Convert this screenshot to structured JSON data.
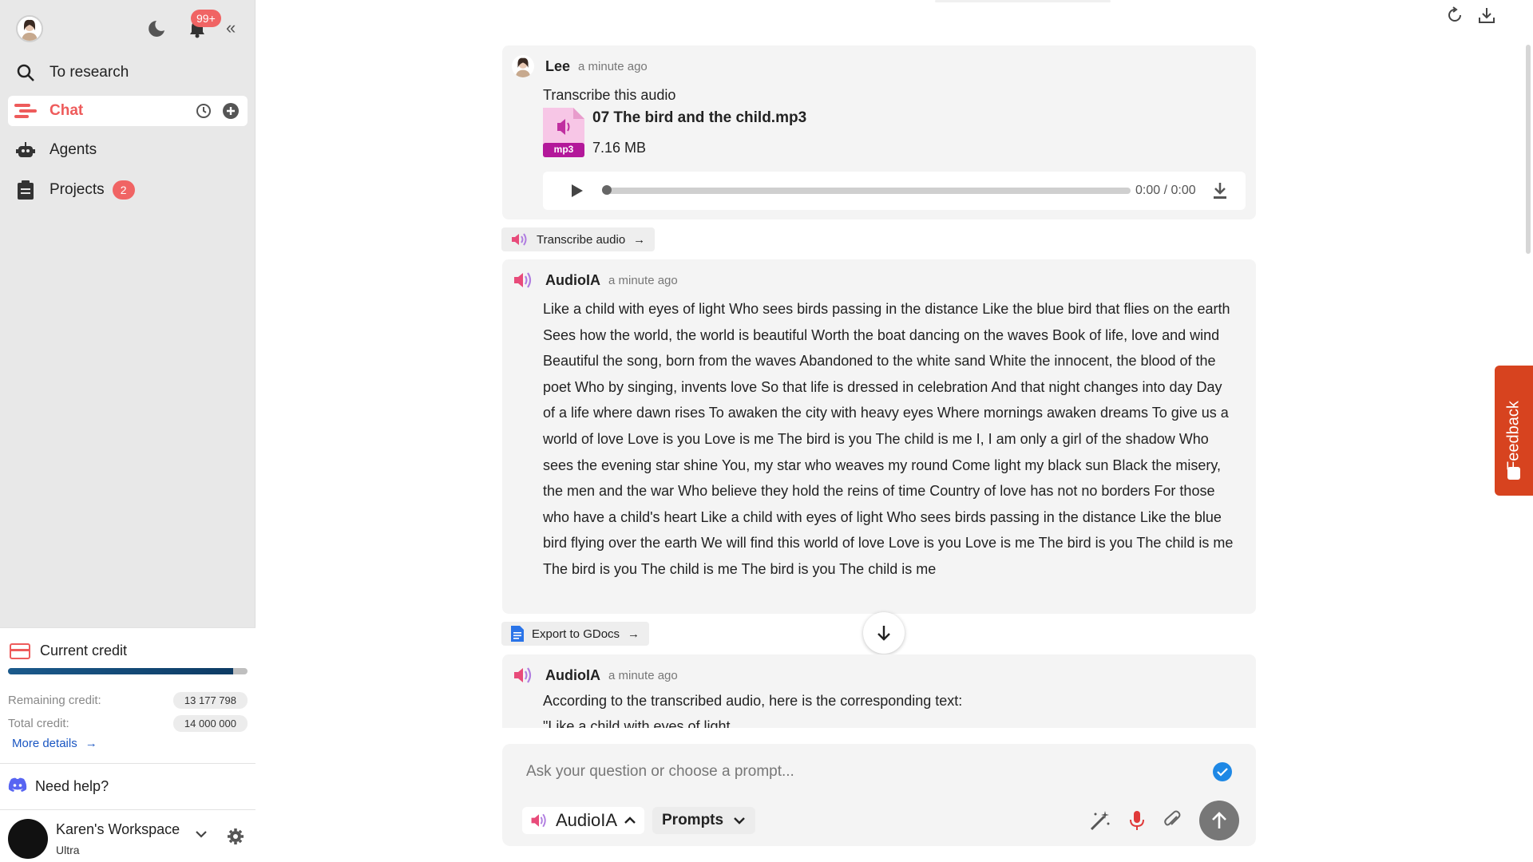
{
  "sidebar": {
    "notifications_badge": "99+",
    "search_label": "To research",
    "nav": {
      "chat": "Chat",
      "agents": "Agents",
      "projects": "Projects",
      "projects_badge": "2"
    },
    "credit": {
      "title": "Current credit",
      "remaining_label": "Remaining credit:",
      "remaining_value": "13 177 798",
      "total_label": "Total credit:",
      "total_value": "14 000 000",
      "progress_fraction": 0.94,
      "more_details": "More details"
    },
    "help": "Need help?",
    "workspace": {
      "name": "Karen's Workspace",
      "plan": "Ultra"
    }
  },
  "messages": {
    "user": {
      "name": "Lee",
      "time": "a minute ago",
      "text": "Transcribe this audio",
      "file_name": "07 The bird and the child.mp3",
      "file_ext": "mp3",
      "file_size": "7.16 MB",
      "audio_time": "0:00 / 0:00"
    },
    "chip_transcribe": "Transcribe audio",
    "ai1": {
      "name": "AudioIA",
      "time": "a minute ago",
      "text": "Like a child with eyes of light Who sees birds passing in the distance Like the blue bird that flies on the earth Sees how the world, the world is beautiful Worth the boat dancing on the waves Book of life, love and wind Beautiful the song, born from the waves Abandoned to the white sand White the innocent, the blood of the poet Who by singing, invents love So that life is dressed in celebration And that night changes into day Day of a life where dawn rises To awaken the city with heavy eyes Where mornings awaken dreams To give us a world of love Love is you Love is me The bird is you The child is me I, I am only a girl of the shadow Who sees the evening star shine You, my star who weaves my round Come light my black sun Black the misery, the men and the war Who believe they hold the reins of time Country of love has not no borders For those who have a child's heart Like a child with eyes of light Who sees birds passing in the distance Like the blue bird flying over the earth We will find this world of love Love is you Love is me The bird is you The child is me The bird is you The child is me The bird is you The child is me"
    },
    "chip_export": "Export to GDocs",
    "ai2": {
      "name": "AudioIA",
      "time": "a minute ago",
      "text": "According to the transcribed audio, here is the corresponding text:",
      "text_cut": "\"Like a child with eyes of light"
    }
  },
  "composer": {
    "placeholder": "Ask your question or choose a prompt...",
    "model": "AudioIA",
    "prompts": "Prompts"
  },
  "feedback": "Feedback"
}
